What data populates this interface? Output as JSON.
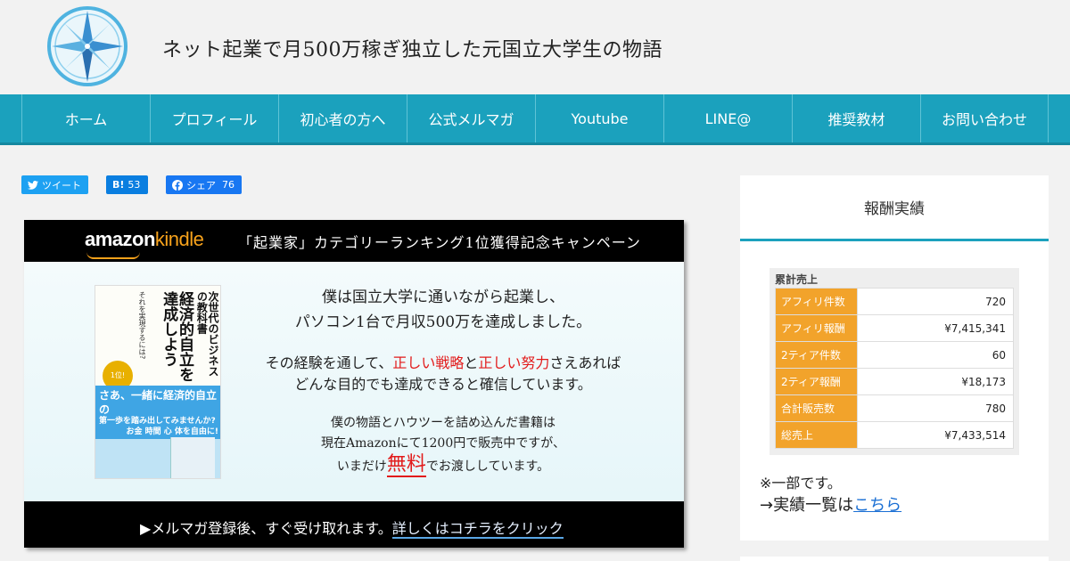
{
  "header": {
    "site_title": "ネット起業で月500万稼ぎ独立した元国立大学生の物語",
    "logo_icon": "compass-logo-icon"
  },
  "nav": {
    "items": [
      {
        "label": "ホーム"
      },
      {
        "label": "プロフィール"
      },
      {
        "label": "初心者の方へ"
      },
      {
        "label": "公式メルマガ"
      },
      {
        "label": "Youtube"
      },
      {
        "label": "LINE@"
      },
      {
        "label": "推奨教材"
      },
      {
        "label": "お問い合わせ"
      }
    ],
    "color": "#1ba1bd"
  },
  "share": {
    "twitter_label": "ツイート",
    "hatena_label": "B!",
    "hatena_count": "53",
    "facebook_label": "シェア",
    "facebook_count": "76"
  },
  "banner": {
    "logo_amazon": "amazon",
    "logo_kindle": "kindle",
    "campaign": "「起業家」カテゴリーランキング1位獲得記念キャンペーン",
    "p1_line1": "僕は国立大学に通いながら起業し、",
    "p1_line2": "パソコン1台で月収500万を達成しました。",
    "p2_a": "その経験を通して、",
    "p2_red1": "正しい戦略",
    "p2_b": "と",
    "p2_red2": "正しい努力",
    "p2_c": "さえあれば",
    "p2_line2": "どんな目的でも達成できると確信しています。",
    "p3_line1": "僕の物語とハウツーを詰め込んだ書籍は",
    "p3_line2": "現在Amazonにて1200円で販売中ですが、",
    "p3_pre": "いまだけ",
    "p3_free": "無料",
    "p3_post": "でお渡ししています。",
    "cta_text": "▶メルマガ登録後、すぐ受け取れます。",
    "cta_link": "詳しくはコチラをクリック",
    "book": {
      "title_small": "次世代のビジネスの教科書",
      "title_big": "経済的自立を達成しよう",
      "subtitle": "それを実現するには?",
      "badge": "1位!",
      "blue_line1": "さあ、一緒に経済的自立の",
      "blue_line2": "第一歩を踏み出してみませんか?",
      "blue_line3": "お金 時間 心 体を自由に!"
    }
  },
  "sidebar": {
    "title": "報酬実績",
    "stats_label": "累計売上",
    "stats": [
      {
        "key": "アフィリ件数",
        "value": "720"
      },
      {
        "key": "アフィリ報酬",
        "value": "¥7,415,341"
      },
      {
        "key": "2ティア件数",
        "value": "60"
      },
      {
        "key": "2ティア報酬",
        "value": "¥18,173"
      },
      {
        "key": "合計販売数",
        "value": "780"
      },
      {
        "key": "総売上",
        "value": "¥7,433,514"
      }
    ],
    "note": "※一部です。",
    "more_prefix": "→実績一覧は",
    "more_link": "こちら"
  }
}
